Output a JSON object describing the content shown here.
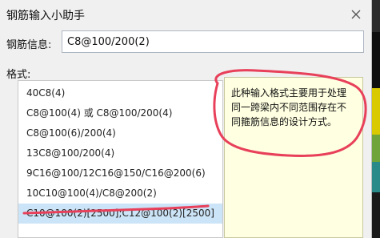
{
  "dialog": {
    "title": "钢筋输入小助手"
  },
  "info": {
    "label": "钢筋信息:",
    "value": "C8@100/200(2)"
  },
  "format": {
    "label": "格式:",
    "items": [
      "40C8(4)",
      "C8@100(4) 或 C8@100/200(4)",
      "C8@100(6)/200(4)",
      "13C8@100/200(4)",
      "9C16@100/12C16@150/C16@200(6)",
      "10C10@100(4)/C8@200(2)",
      "C10@100(2)[2500];C12@100(2)[2500]"
    ],
    "selected_index": 6
  },
  "description": {
    "text": "此种输入格式主要用于处理同一跨梁内不同范围存在不同箍筋信息的设计方式。"
  },
  "colors": {
    "annotation": "#e8405a",
    "selected_row": "#cce4f7",
    "tooltip_bg": "#ffffe1"
  }
}
